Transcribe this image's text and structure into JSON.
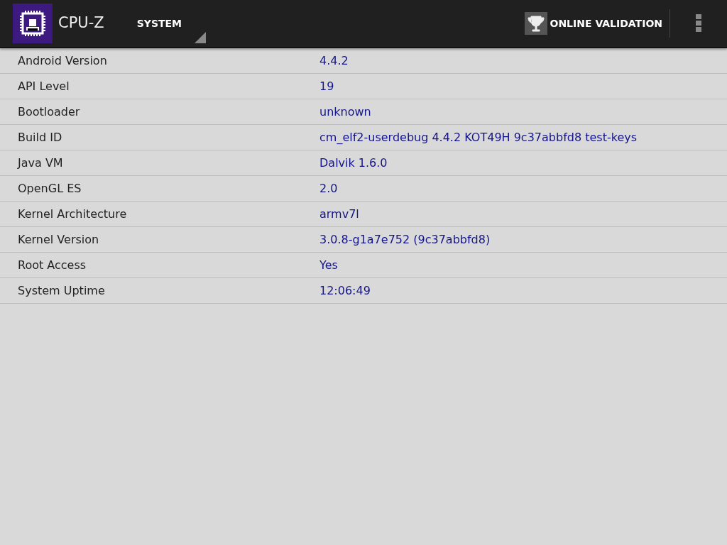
{
  "app_bar": {
    "title": "CPU-Z",
    "section": "SYSTEM",
    "action": "ONLINE VALIDATION"
  },
  "rows": [
    {
      "label": "Android Version",
      "value": "4.4.2"
    },
    {
      "label": "API Level",
      "value": "19"
    },
    {
      "label": "Bootloader",
      "value": "unknown"
    },
    {
      "label": "Build ID",
      "value": "cm_elf2-userdebug 4.4.2 KOT49H 9c37abbfd8 test-keys"
    },
    {
      "label": "Java VM",
      "value": "Dalvik 1.6.0"
    },
    {
      "label": "OpenGL ES",
      "value": "2.0"
    },
    {
      "label": "Kernel Architecture",
      "value": "armv7l"
    },
    {
      "label": "Kernel Version",
      "value": "3.0.8-g1a7e752 (9c37abbfd8)"
    },
    {
      "label": "Root Access",
      "value": "Yes"
    },
    {
      "label": "System Uptime",
      "value": "12:06:49"
    }
  ]
}
